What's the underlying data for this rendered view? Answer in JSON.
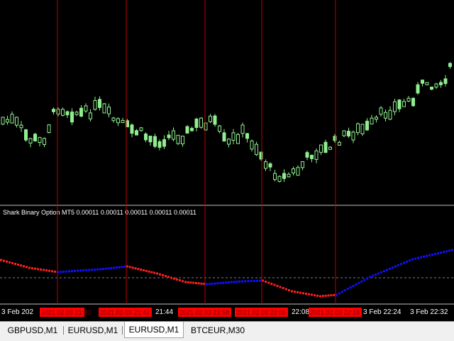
{
  "indicator": {
    "label": "Shark Binary Option MT5 0.00011 0.00011 0.00011 0.00011 0.00011"
  },
  "time_axis": {
    "labels": [
      "3 Feb 202",
      "3 Feb 21:28",
      "21:44",
      "3 Feb 22:24",
      "3 Feb 22:32",
      "22:08"
    ],
    "highlighted": [
      "2021.02.03 21:30",
      "2021.02.03 21:42",
      "2021.02.03 21:58",
      "2021.02.03 22:06",
      "2021.02.03 22:18"
    ]
  },
  "tabs": [
    {
      "label": "GBPUSD,M1"
    },
    {
      "label": "EURUSD,M1"
    },
    {
      "label": "EURUSD,M1"
    },
    {
      "label": "BTCEUR,M30"
    }
  ],
  "colors": {
    "candle": "#90ee90",
    "vline": "#c00000",
    "line_down": "#ff2020",
    "line_up": "#1010ff",
    "time_highlight": "#ff0000",
    "panel_border": "#c0c0c0"
  }
}
